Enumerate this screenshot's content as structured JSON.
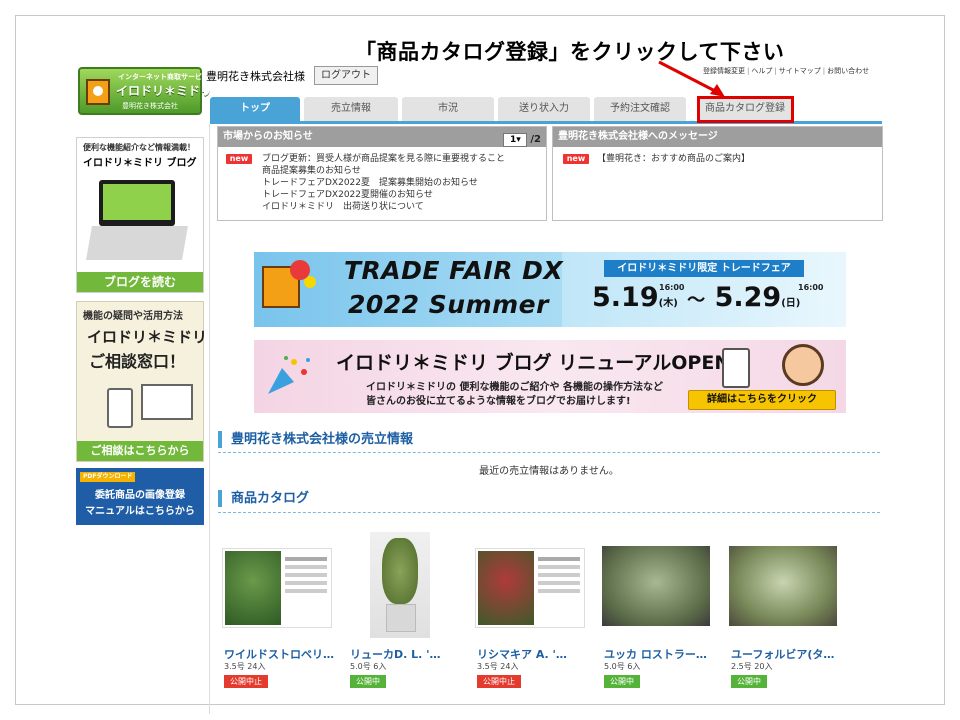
{
  "instruction": "「商品カタログ登録」をクリックして下さい",
  "logo": {
    "line1": "インターネット商取サービス",
    "line2": "イロドリ＊ミドリ",
    "line3": "豊明花き株式会社"
  },
  "header": {
    "company": "豊明花き株式会社様",
    "logout": "ログアウト",
    "links": [
      "登録情報変更",
      "ヘルプ",
      "サイトマップ",
      "お問い合わせ"
    ]
  },
  "tabs": [
    "トップ",
    "売立情報",
    "市況",
    "送り状入力",
    "予約注文確認",
    "商品カタログ登録"
  ],
  "sidebar": {
    "blog": {
      "line1": "便利な機能紹介など情報満載！",
      "line2": "イロドリ＊ミドリ ブログ",
      "button": "ブログを読む"
    },
    "consult": {
      "line1": "機能の疑問や活用方法",
      "line2": "イロドリ＊ミドリ",
      "line3": "ご相談窓口！",
      "button": "ご相談はこちらから"
    },
    "pdf": {
      "tag": "PDFダウンロード",
      "line1": "委託商品の画像登録",
      "line2": "マニュアルはこちらから"
    }
  },
  "market_notice": {
    "title": "市場からのお知らせ",
    "page_current": "1",
    "page_total": "/2",
    "badge": "new",
    "items": [
      "ブログ更新：買受人様が商品提案を見る際に重要視すること",
      "商品提案募集のお知らせ",
      "トレードフェアDX2022夏　提案募集開始のお知らせ",
      "トレードフェアDX2022夏開催のお知らせ",
      "イロドリ＊ミドリ　出荷送り状について"
    ]
  },
  "message": {
    "title": "豊明花き株式会社様へのメッセージ",
    "badge": "new",
    "item": "【豊明花き：おすすめ商品のご案内】"
  },
  "banner_trade": {
    "title1": "TRADE FAIR DX",
    "title2": "2022 Summer",
    "tag": "イロドリ＊ミドリ限定 トレードフェア",
    "start_date": "5.19",
    "start_time": "16:00",
    "start_day": "(木)",
    "tilde": "～",
    "end_date": "5.29",
    "end_time": "16:00",
    "end_day": "(日)"
  },
  "banner_blog": {
    "title": "イロドリ＊ミドリ ブログ リニューアルOPEN!",
    "line1": "イロドリ＊ミドリの 便利な機能のご紹介や 各機能の操作方法など",
    "line2": "皆さんのお役に立てるような情報をブログでお届けします!",
    "button": "詳細はこちらをクリック"
  },
  "sales_section": {
    "title": "豊明花き株式会社様の売立情報",
    "empty": "最近の売立情報はありません。"
  },
  "catalog_section": {
    "title": "商品カタログ",
    "products": [
      {
        "name": "ワイルドストロベリ…",
        "info": "3.5号 24入",
        "status": "公開中止"
      },
      {
        "name": "リューカD. L. '…",
        "info": "5.0号 6入",
        "status": "公開中"
      },
      {
        "name": "リシマキア A. '…",
        "info": "3.5号 24入",
        "status": "公開中止"
      },
      {
        "name": "ユッカ ロストラー…",
        "info": "5.0号 6入",
        "status": "公開中"
      },
      {
        "name": "ユーフォルビア(タ…",
        "info": "2.5号 20入",
        "status": "公開中"
      }
    ]
  },
  "colors": {
    "accent_blue": "#4aa3d6",
    "highlight_red": "#e10000",
    "status_stopped": "#e33b2e",
    "status_active": "#55b33a"
  }
}
